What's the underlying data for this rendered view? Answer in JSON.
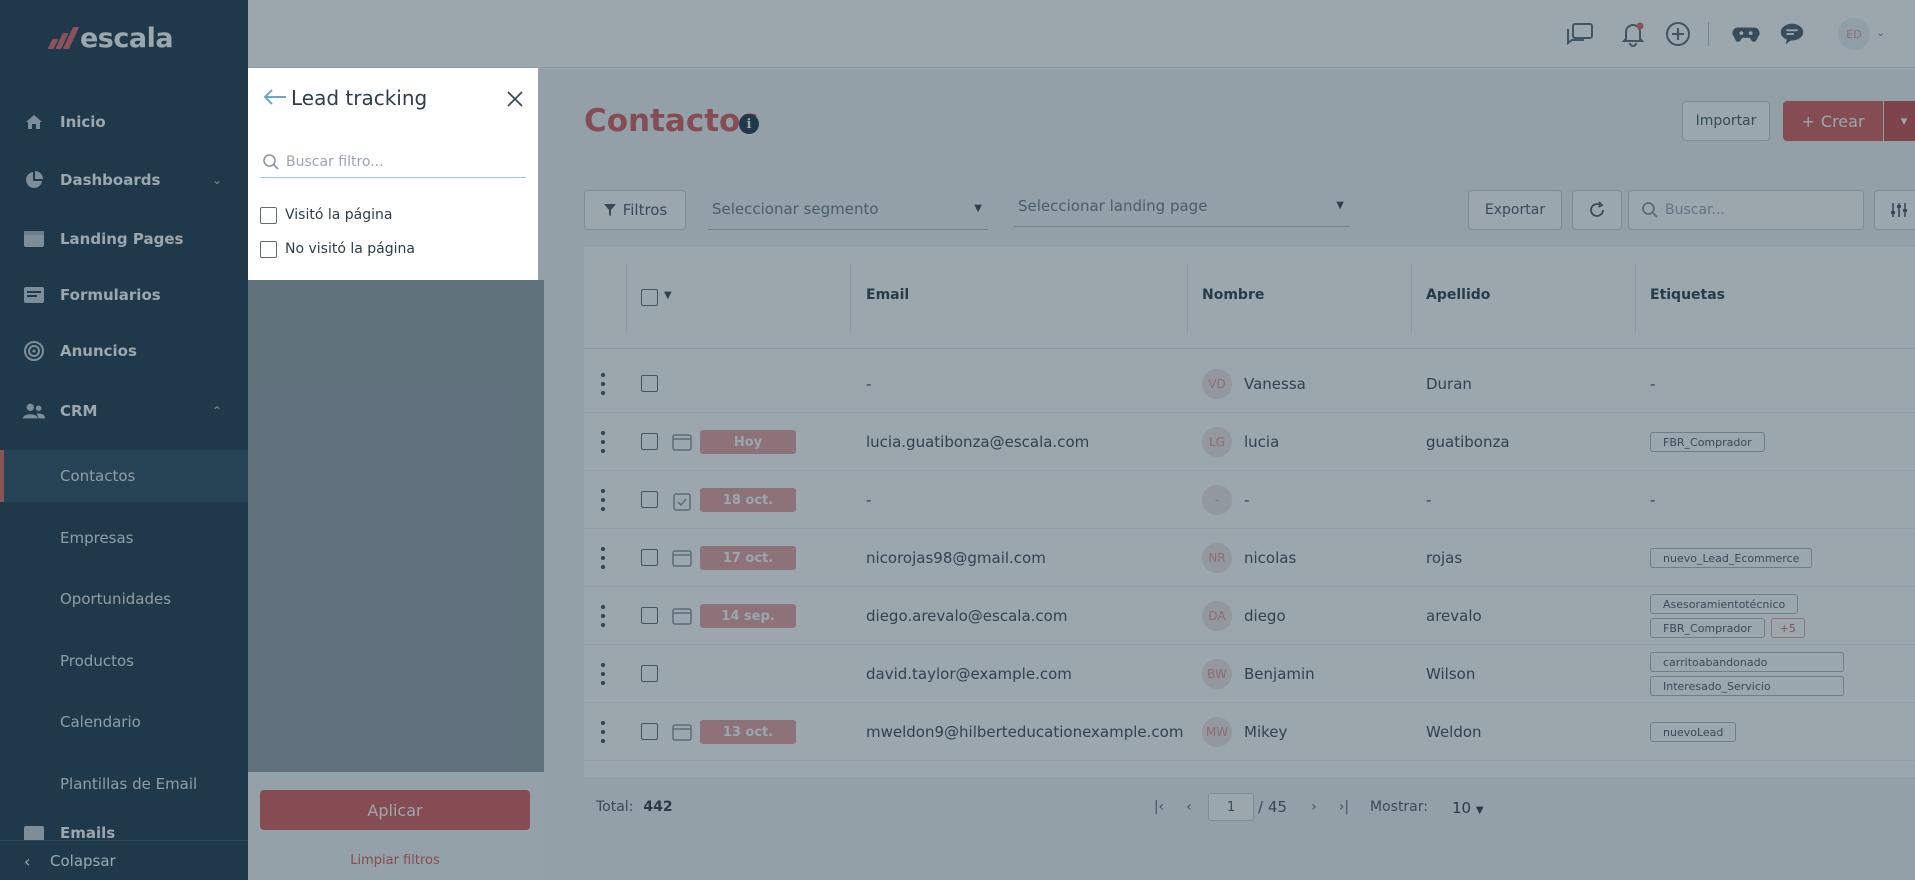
{
  "brand": {
    "name": "escala"
  },
  "sidebar": {
    "items": [
      {
        "label": "Inicio",
        "icon": "home-icon"
      },
      {
        "label": "Dashboards",
        "icon": "pie-chart-icon"
      },
      {
        "label": "Landing Pages",
        "icon": "browser-icon"
      },
      {
        "label": "Formularios",
        "icon": "form-icon"
      },
      {
        "label": "Anuncios",
        "icon": "target-icon"
      },
      {
        "label": "CRM",
        "icon": "users-icon"
      }
    ],
    "crm_sub": [
      "Contactos",
      "Empresas",
      "Oportunidades",
      "Productos",
      "Calendario",
      "Plantillas de Email",
      "Emails"
    ],
    "collapse_label": "Colapsar"
  },
  "topbar": {
    "avatar_initials": "ED"
  },
  "page": {
    "title": "Contactos",
    "import_label": "Importar",
    "create_label": "Crear",
    "filters_label": "Filtros",
    "segment_placeholder": "Seleccionar segmento",
    "landing_placeholder": "Seleccionar landing page",
    "export_label": "Exportar",
    "search_placeholder": "Buscar..."
  },
  "table": {
    "headers": {
      "email": "Email",
      "nombre": "Nombre",
      "apellido": "Apellido",
      "etiquetas": "Etiquetas"
    },
    "rows": [
      {
        "date": "",
        "email": "-",
        "initials": "VD",
        "nombre": "Vanessa",
        "apellido": "Duran",
        "tags": [],
        "tags_text": "-"
      },
      {
        "date": "Hoy",
        "email": "lucia.guatibonza@escala.com",
        "initials": "LG",
        "nombre": "lucia",
        "apellido": "guatibonza",
        "tags": [
          "FBR_Comprador"
        ]
      },
      {
        "date": "18 oct.",
        "email": "-",
        "initials": "-",
        "nombre": "-",
        "apellido": "-",
        "tags": [],
        "tags_text": "-"
      },
      {
        "date": "17 oct.",
        "email": "nicorojas98@gmail.com",
        "initials": "NR",
        "nombre": "nicolas",
        "apellido": "rojas",
        "tags": [
          "nuevo_Lead_Ecommerce"
        ]
      },
      {
        "date": "14 sep.",
        "email": "diego.arevalo@escala.com",
        "initials": "DA",
        "nombre": "diego",
        "apellido": "arevalo",
        "tags": [
          "Asesoramientotécnico",
          "FBR_Comprador",
          "+5"
        ]
      },
      {
        "date": "",
        "email": "david.taylor@example.com",
        "initials": "BW",
        "nombre": "Benjamin",
        "apellido": "Wilson",
        "tags": [
          "carritoabandonado",
          "Interesado_Servicio"
        ]
      },
      {
        "date": "13 oct.",
        "email": "mweldon9@hilberteducationexample.com",
        "initials": "MW",
        "nombre": "Mikey",
        "apellido": "Weldon",
        "tags": [
          "nuevoLead"
        ]
      }
    ]
  },
  "footer": {
    "total_label": "Total:",
    "total_value": "442",
    "page_current": "1",
    "page_total": "/ 45",
    "show_label": "Mostrar:",
    "show_value": "10"
  },
  "drawer": {
    "title": "Lead tracking",
    "search_placeholder": "Buscar filtro...",
    "options": [
      "Visitó la página",
      "No visitó la página"
    ],
    "apply_label": "Aplicar",
    "clear_label": "Limpiar filtros"
  },
  "colors": {
    "accent": "#d95b5b",
    "sidebar": "#1e3a4c"
  }
}
